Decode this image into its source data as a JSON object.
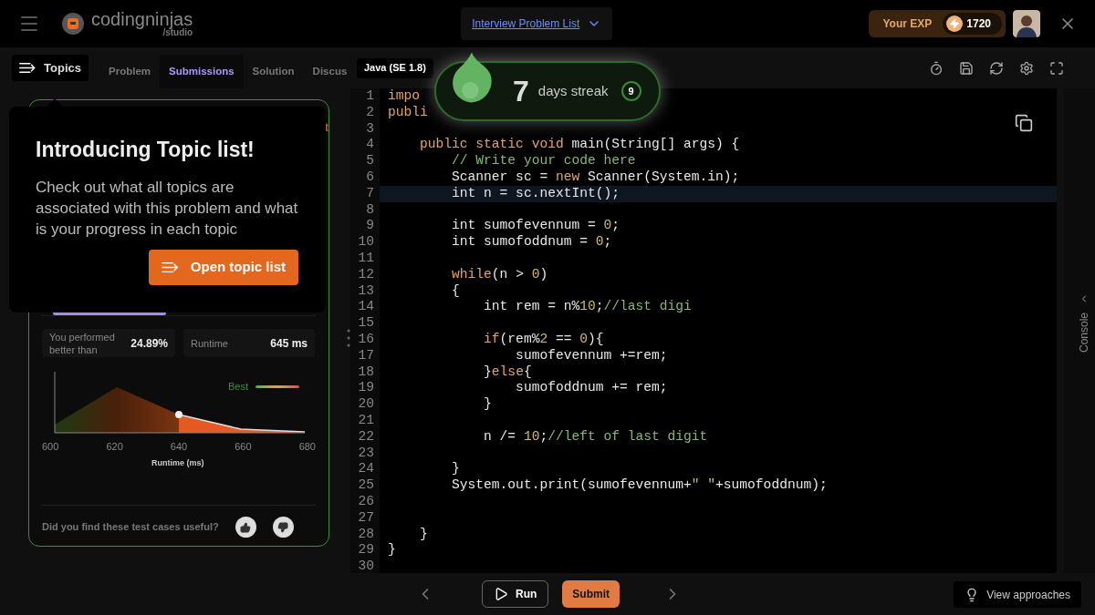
{
  "header": {
    "brand": {
      "name": "codingninjas",
      "sub": "/studio"
    },
    "problem_list_link": "Interview Problem List",
    "exp": {
      "label": "Your EXP",
      "value": "1720"
    }
  },
  "topics_button": "Topics",
  "tabs": [
    {
      "label": "Problem",
      "selected": false
    },
    {
      "label": "Submissions",
      "selected": true
    },
    {
      "label": "Solution",
      "selected": false
    },
    {
      "label": "Discus",
      "selected": false
    }
  ],
  "language": "Java (SE 1.8)",
  "streak": {
    "count": "7",
    "label": "days streak",
    "best": "9"
  },
  "tour": {
    "title": "Introducing Topic list!",
    "body": "Check out what all topics are associated with this problem and what is your progress in each topic",
    "button": "Open topic list"
  },
  "submission": {
    "hidden_text": "t",
    "stats": [
      {
        "label": "You performed better than",
        "value": "24.89%"
      },
      {
        "label": "Runtime",
        "value": "645 ms"
      }
    ],
    "legend": "Best",
    "tick_labels": [
      "600",
      "620",
      "640",
      "660",
      "680"
    ],
    "xlabel": "Runtime (ms)",
    "question": "Did you find these test cases useful?"
  },
  "editor": {
    "lines": [
      {
        "n": "1",
        "current": false,
        "tokens": [
          {
            "kind": "kw",
            "text": "impo"
          }
        ]
      },
      {
        "n": "2",
        "current": false,
        "tokens": [
          {
            "kind": "kw",
            "text": "publi"
          }
        ]
      },
      {
        "n": "3",
        "current": false
      },
      {
        "n": "4",
        "current": false,
        "tokens": [
          {
            "kind": "kw",
            "text": "    public static void"
          },
          {
            "kind": "pl",
            "text": " main(String[] args) {"
          }
        ]
      },
      {
        "n": "5",
        "current": false,
        "tokens": [
          {
            "kind": "cm",
            "text": "        // Write your code here"
          }
        ]
      },
      {
        "n": "6",
        "current": false,
        "tokens": [
          {
            "kind": "pl",
            "text": "        Scanner sc = "
          },
          {
            "kind": "kw",
            "text": "new"
          },
          {
            "kind": "pl",
            "text": " Scanner(System.in);"
          }
        ]
      },
      {
        "n": "7",
        "current": true,
        "tokens": [
          {
            "kind": "pl",
            "text": "        int n = sc.nextInt();"
          }
        ]
      },
      {
        "n": "8",
        "current": false
      },
      {
        "n": "9",
        "current": false,
        "tokens": [
          {
            "kind": "pl",
            "text": "        int sumofevennum = "
          },
          {
            "kind": "nm",
            "text": "0"
          },
          {
            "kind": "pl",
            "text": ";"
          }
        ]
      },
      {
        "n": "10",
        "current": false,
        "tokens": [
          {
            "kind": "pl",
            "text": "        int sumofoddnum = "
          },
          {
            "kind": "nm",
            "text": "0"
          },
          {
            "kind": "pl",
            "text": ";"
          }
        ]
      },
      {
        "n": "11",
        "current": false
      },
      {
        "n": "12",
        "current": false,
        "tokens": [
          {
            "kind": "kw",
            "text": "        while"
          },
          {
            "kind": "pl",
            "text": "(n > "
          },
          {
            "kind": "nm",
            "text": "0"
          },
          {
            "kind": "pl",
            "text": ")"
          }
        ]
      },
      {
        "n": "13",
        "current": false,
        "tokens": [
          {
            "kind": "pl",
            "text": "        {"
          }
        ]
      },
      {
        "n": "14",
        "current": false,
        "tokens": [
          {
            "kind": "pl",
            "text": "            int rem = n%"
          },
          {
            "kind": "nm",
            "text": "10"
          },
          {
            "kind": "pl",
            "text": ";"
          },
          {
            "kind": "cm",
            "text": "//last digi"
          }
        ]
      },
      {
        "n": "15",
        "current": false
      },
      {
        "n": "16",
        "current": false,
        "tokens": [
          {
            "kind": "kw",
            "text": "            if"
          },
          {
            "kind": "pl",
            "text": "(rem%"
          },
          {
            "kind": "nm",
            "text": "2"
          },
          {
            "kind": "pl",
            "text": " == "
          },
          {
            "kind": "nm",
            "text": "0"
          },
          {
            "kind": "pl",
            "text": "){"
          }
        ]
      },
      {
        "n": "17",
        "current": false,
        "tokens": [
          {
            "kind": "pl",
            "text": "                sumofevennum +=rem;"
          }
        ]
      },
      {
        "n": "18",
        "current": false,
        "tokens": [
          {
            "kind": "pl",
            "text": "            }"
          },
          {
            "kind": "kw",
            "text": "else"
          },
          {
            "kind": "pl",
            "text": "{"
          }
        ]
      },
      {
        "n": "19",
        "current": false,
        "tokens": [
          {
            "kind": "pl",
            "text": "                sumofoddnum += rem;"
          }
        ]
      },
      {
        "n": "20",
        "current": false,
        "tokens": [
          {
            "kind": "pl",
            "text": "            }"
          }
        ]
      },
      {
        "n": "21",
        "current": false
      },
      {
        "n": "22",
        "current": false,
        "tokens": [
          {
            "kind": "pl",
            "text": "            n /= "
          },
          {
            "kind": "nm",
            "text": "10"
          },
          {
            "kind": "pl",
            "text": ";"
          },
          {
            "kind": "cm",
            "text": "//left of last digit"
          }
        ]
      },
      {
        "n": "23",
        "current": false
      },
      {
        "n": "24",
        "current": false,
        "tokens": [
          {
            "kind": "pl",
            "text": "        }"
          }
        ]
      },
      {
        "n": "25",
        "current": false,
        "tokens": [
          {
            "kind": "pl",
            "text": "        System.out.print(sumofevennum+"
          },
          {
            "kind": "nm",
            "text": "\" \""
          },
          {
            "kind": "pl",
            "text": "+sumofoddnum);"
          }
        ]
      },
      {
        "n": "26",
        "current": false
      },
      {
        "n": "27",
        "current": false
      },
      {
        "n": "28",
        "current": false,
        "tokens": [
          {
            "kind": "pl",
            "text": "    }"
          }
        ]
      },
      {
        "n": "29",
        "current": false,
        "tokens": [
          {
            "kind": "pl",
            "text": "}"
          }
        ]
      },
      {
        "n": "30",
        "current": false
      }
    ]
  },
  "console": "Console",
  "footer": {
    "run": "Run",
    "submit": "Submit",
    "approaches": "View approaches"
  }
}
